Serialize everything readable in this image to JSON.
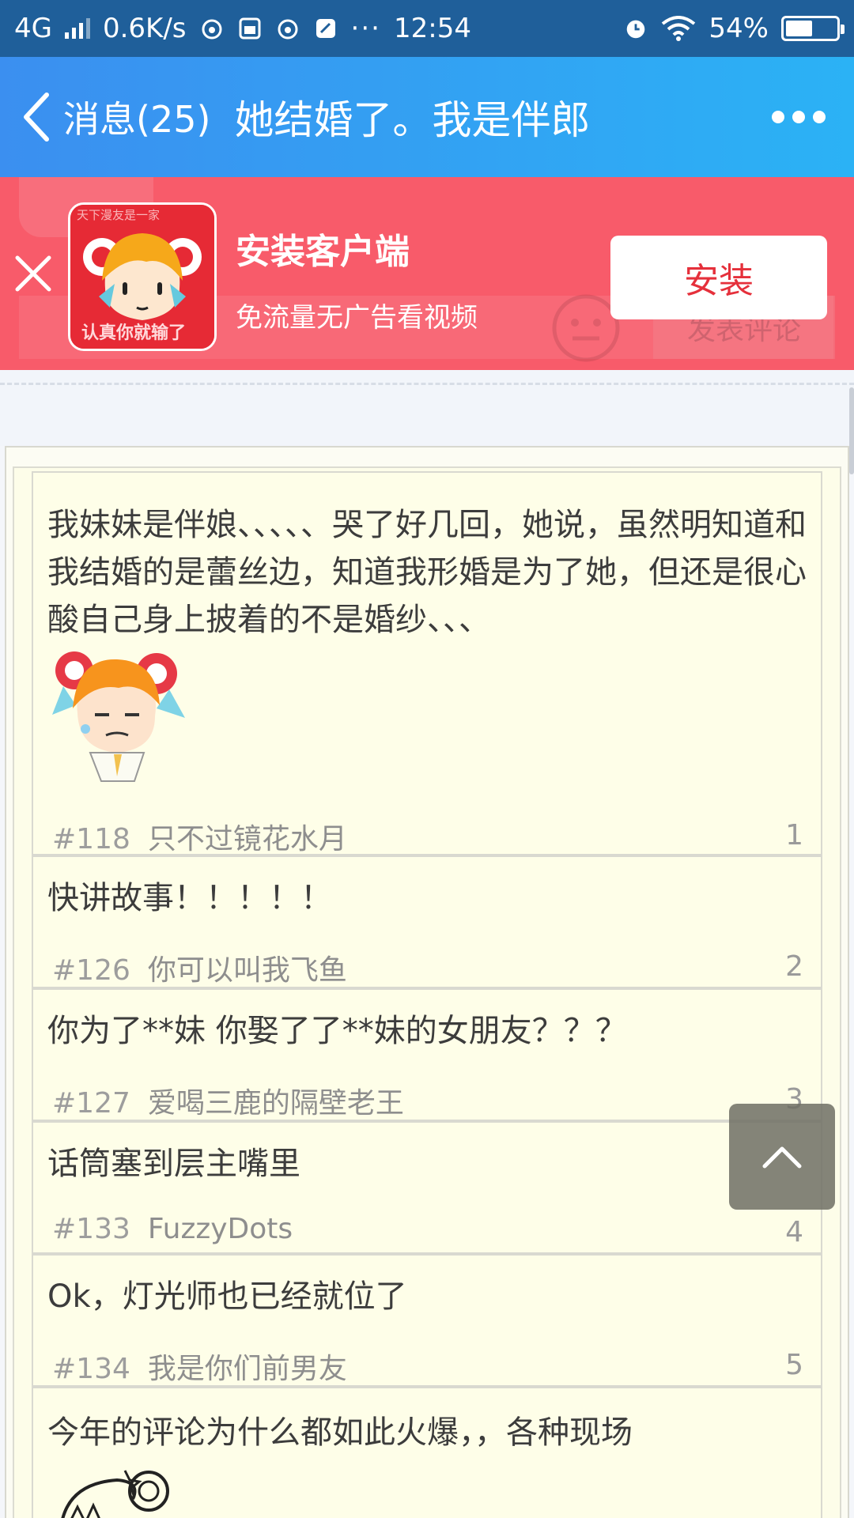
{
  "status_bar": {
    "network": "4G",
    "speed": "0.6K/s",
    "time": "12:54",
    "battery_percent": "54%",
    "battery_level": 0.54,
    "icons": [
      "signal-icon",
      "weibo-icon",
      "vivo-icon",
      "weibo-icon",
      "app-icon",
      "more-dots",
      "alarm-icon",
      "wifi-icon",
      "battery-icon"
    ]
  },
  "header": {
    "back_label": "消息(25)",
    "title": "她结婚了。我是伴郎",
    "back_icon": "chevron-left-icon",
    "menu_icon": "more-horizontal-icon"
  },
  "banner": {
    "title": "安装客户端",
    "subtitle": "免流量无广告看视频",
    "install_label": "安装",
    "icon_lines": [
      "天下漫友是一家",
      "认真你就输了"
    ],
    "ghost_button": "发表评论",
    "background": "#f85b6a"
  },
  "comments": [
    {
      "text": "我妹妹是伴娘、、、、、哭了好几回，她说，虽然明知道和我结婚的是蕾丝边，知道我形婚是为了她，但还是很心酸自己身上披着的不是婚纱、、、",
      "floor": "#118",
      "user": "只不过镜花水月",
      "index": "1",
      "has_sticker": true
    },
    {
      "text": "快讲故事！！！！！",
      "floor": "#126",
      "user": "你可以叫我飞鱼",
      "index": "2"
    },
    {
      "text": "你为了**妹  你娶了了**妹的女朋友？？？",
      "floor": "#127",
      "user": "爱喝三鹿的隔壁老王",
      "index": "3"
    },
    {
      "text": "话筒塞到层主嘴里",
      "floor": "#133",
      "user": "FuzzyDots",
      "index": "4"
    },
    {
      "text": "Ok，灯光师也已经就位了",
      "floor": "#134",
      "user": "我是你们前男友",
      "index": "5"
    },
    {
      "text": "今年的评论为什么都如此火爆，，各种现场",
      "has_sticker": true
    }
  ],
  "back_to_top_icon": "chevron-up-icon"
}
